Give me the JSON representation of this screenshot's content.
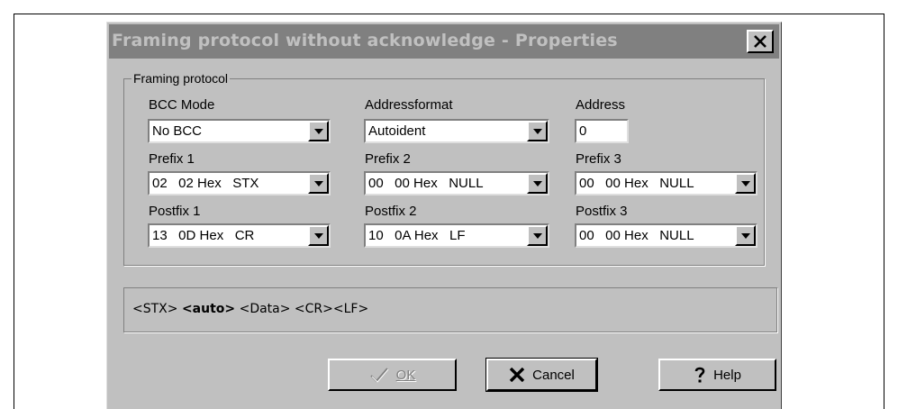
{
  "dialog": {
    "title": "Framing protocol without acknowledge - Properties",
    "close_label": "✕"
  },
  "group": {
    "legend": "Framing protocol",
    "fields": [
      {
        "label": "BCC Mode",
        "value": "No BCC"
      },
      {
        "label": "Addressformat",
        "value": "Autoident"
      },
      {
        "label": "Address",
        "value": "0"
      },
      {
        "label": "Prefix 1",
        "value": "02   02 Hex   STX"
      },
      {
        "label": "Prefix 2",
        "value": "00   00 Hex   NULL"
      },
      {
        "label": "Prefix 3",
        "value": "00   00 Hex   NULL"
      },
      {
        "label": "Postfix 1",
        "value": "13   0D Hex   CR"
      },
      {
        "label": "Postfix 2",
        "value": "10   0A Hex   LF"
      },
      {
        "label": "Postfix 3",
        "value": "00   00 Hex   NULL"
      }
    ]
  },
  "preview": {
    "part1": "<STX> ",
    "bold": "<auto>",
    "part2": " <Data> <CR><LF>"
  },
  "buttons": {
    "ok": {
      "label": "OK",
      "icon": "checkmark-icon",
      "enabled": false
    },
    "cancel": {
      "label": "Cancel",
      "icon": "x-icon"
    },
    "help": {
      "label": "Help",
      "icon": "question-icon"
    }
  }
}
